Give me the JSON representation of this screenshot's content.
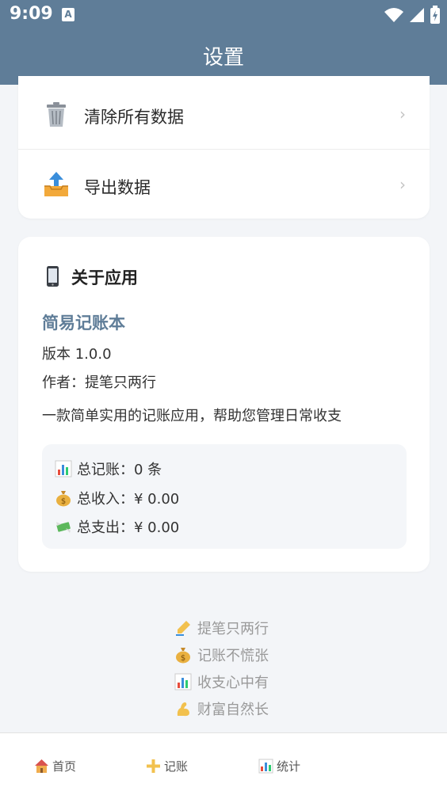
{
  "status_bar": {
    "time": "9:09",
    "a_badge": "A"
  },
  "header": {
    "title": "设置"
  },
  "data_card": {
    "items": [
      {
        "label": "清除所有数据",
        "icon": "trash-icon",
        "chevron": "›"
      },
      {
        "label": "导出数据",
        "icon": "export-icon",
        "chevron": "›"
      }
    ]
  },
  "about": {
    "heading": "关于应用",
    "app_name": "简易记账本",
    "version": "版本 1.0.0",
    "author": "作者：提笔只两行",
    "description": "一款简单实用的记账应用，帮助您管理日常收支",
    "stats": [
      {
        "icon": "bar-chart-icon",
        "text": "总记账：0 条"
      },
      {
        "icon": "money-bag-icon",
        "text": "总收入：¥ 0.00"
      },
      {
        "icon": "money-wings-icon",
        "text": "总支出：¥ 0.00"
      }
    ]
  },
  "slogans": [
    {
      "icon": "writing-hand-icon",
      "text": "提笔只两行"
    },
    {
      "icon": "money-bag-icon",
      "text": "记账不慌张"
    },
    {
      "icon": "bar-chart-icon",
      "text": "收支心中有"
    },
    {
      "icon": "flexed-arm-icon",
      "text": "财富自然长"
    }
  ],
  "bottom_nav": [
    {
      "icon": "home-icon",
      "label": "首页"
    },
    {
      "icon": "plus-icon",
      "label": "记账"
    },
    {
      "icon": "bar-chart-icon",
      "label": "统计"
    }
  ],
  "colors": {
    "primary": "#5f7d98",
    "background": "#f3f5f8"
  }
}
